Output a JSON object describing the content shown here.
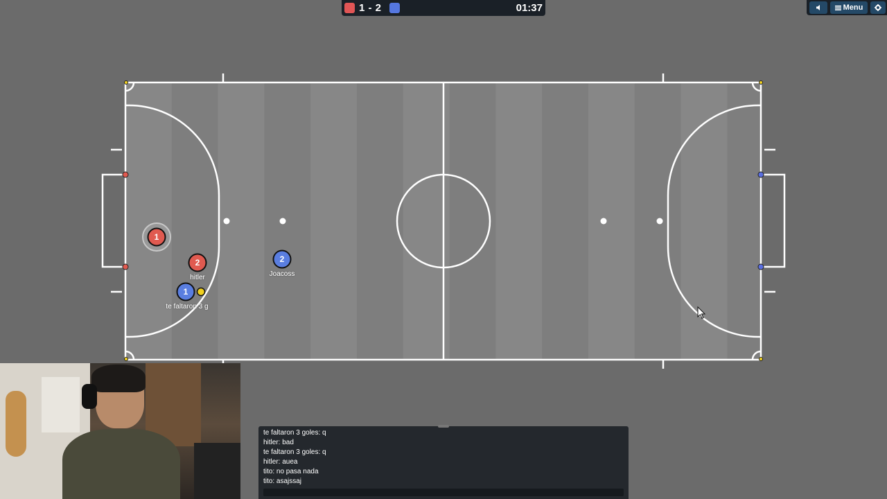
{
  "scoreboard": {
    "score": "1 - 2",
    "timer": "01:37",
    "red_color": "#e05555",
    "blue_color": "#5577e0"
  },
  "top_menu": {
    "sound_icon": "speaker-icon",
    "menu_label": "Menu",
    "menu_icon": "hamburger-icon",
    "settings_icon": "gear-icon"
  },
  "colors": {
    "field": "#858585",
    "stripe": "#7f7f7f",
    "lines": "#ffffff",
    "red_team": "#e05a50",
    "blue_team": "#5a7ee0",
    "ball": "#f0d020"
  },
  "players": [
    {
      "team": "red",
      "number": "1",
      "name": "",
      "controlled": true
    },
    {
      "team": "red",
      "number": "2",
      "name": "hitler",
      "controlled": false
    },
    {
      "team": "blue",
      "number": "1",
      "name": "te faltaron 3 g",
      "controlled": false
    },
    {
      "team": "blue",
      "number": "2",
      "name": "Joacoss",
      "controlled": false
    }
  ],
  "chat": {
    "messages": [
      "te faltaron 3 goles: q",
      "hitler: bad",
      "te faltaron 3 goles: q",
      "hitler: auea",
      "tito: no pasa nada",
      "tito: asajssaj"
    ]
  }
}
